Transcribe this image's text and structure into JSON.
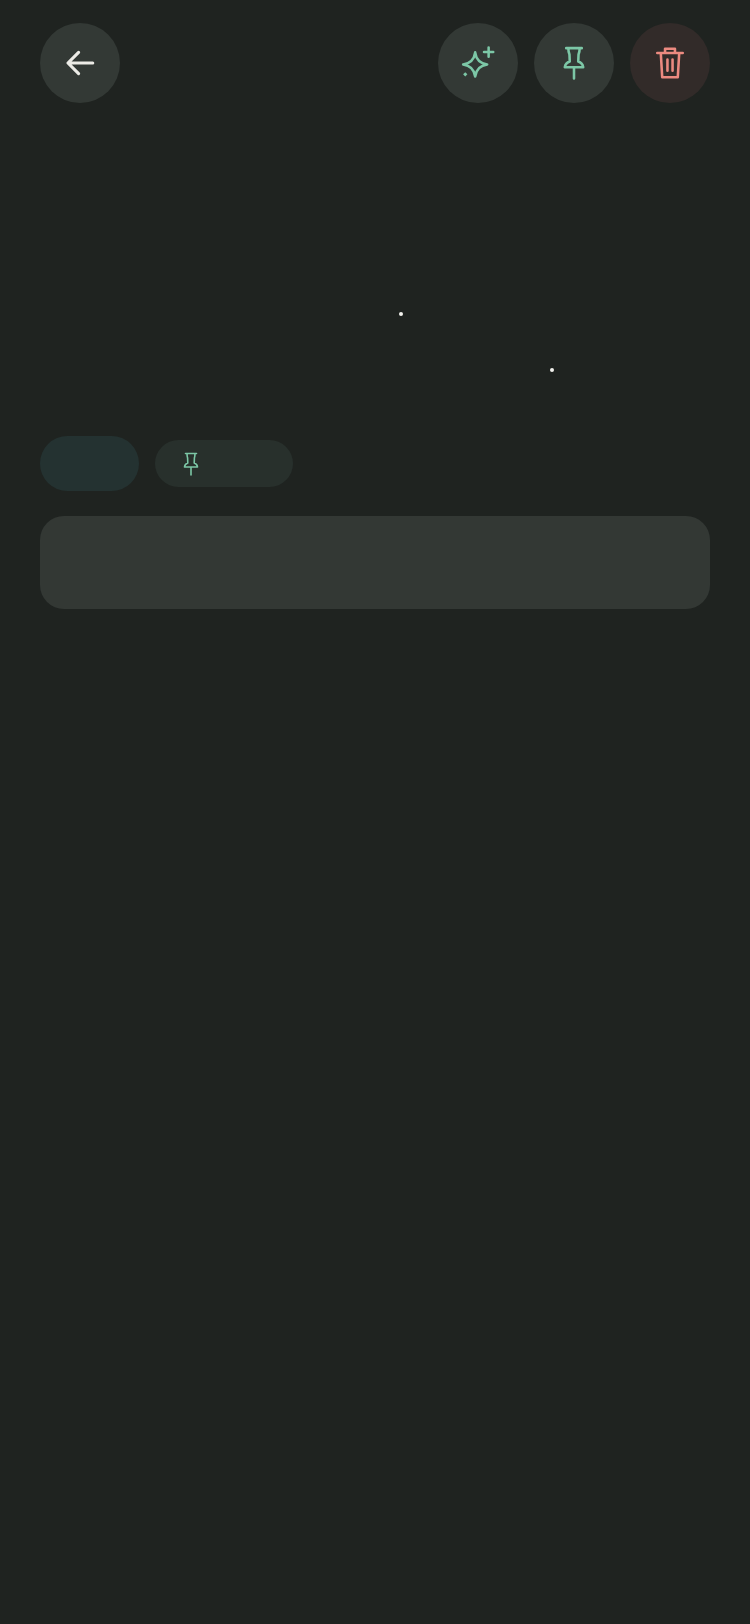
{
  "toolbar": {
    "buttons": [
      {
        "kind": "back"
      },
      {
        "kind": "sparkle"
      },
      {
        "kind": "pin"
      },
      {
        "kind": "delete"
      }
    ]
  },
  "chips": [
    {
      "kind": "plain",
      "selected": true
    },
    {
      "kind": "pin",
      "selected": false
    }
  ]
}
